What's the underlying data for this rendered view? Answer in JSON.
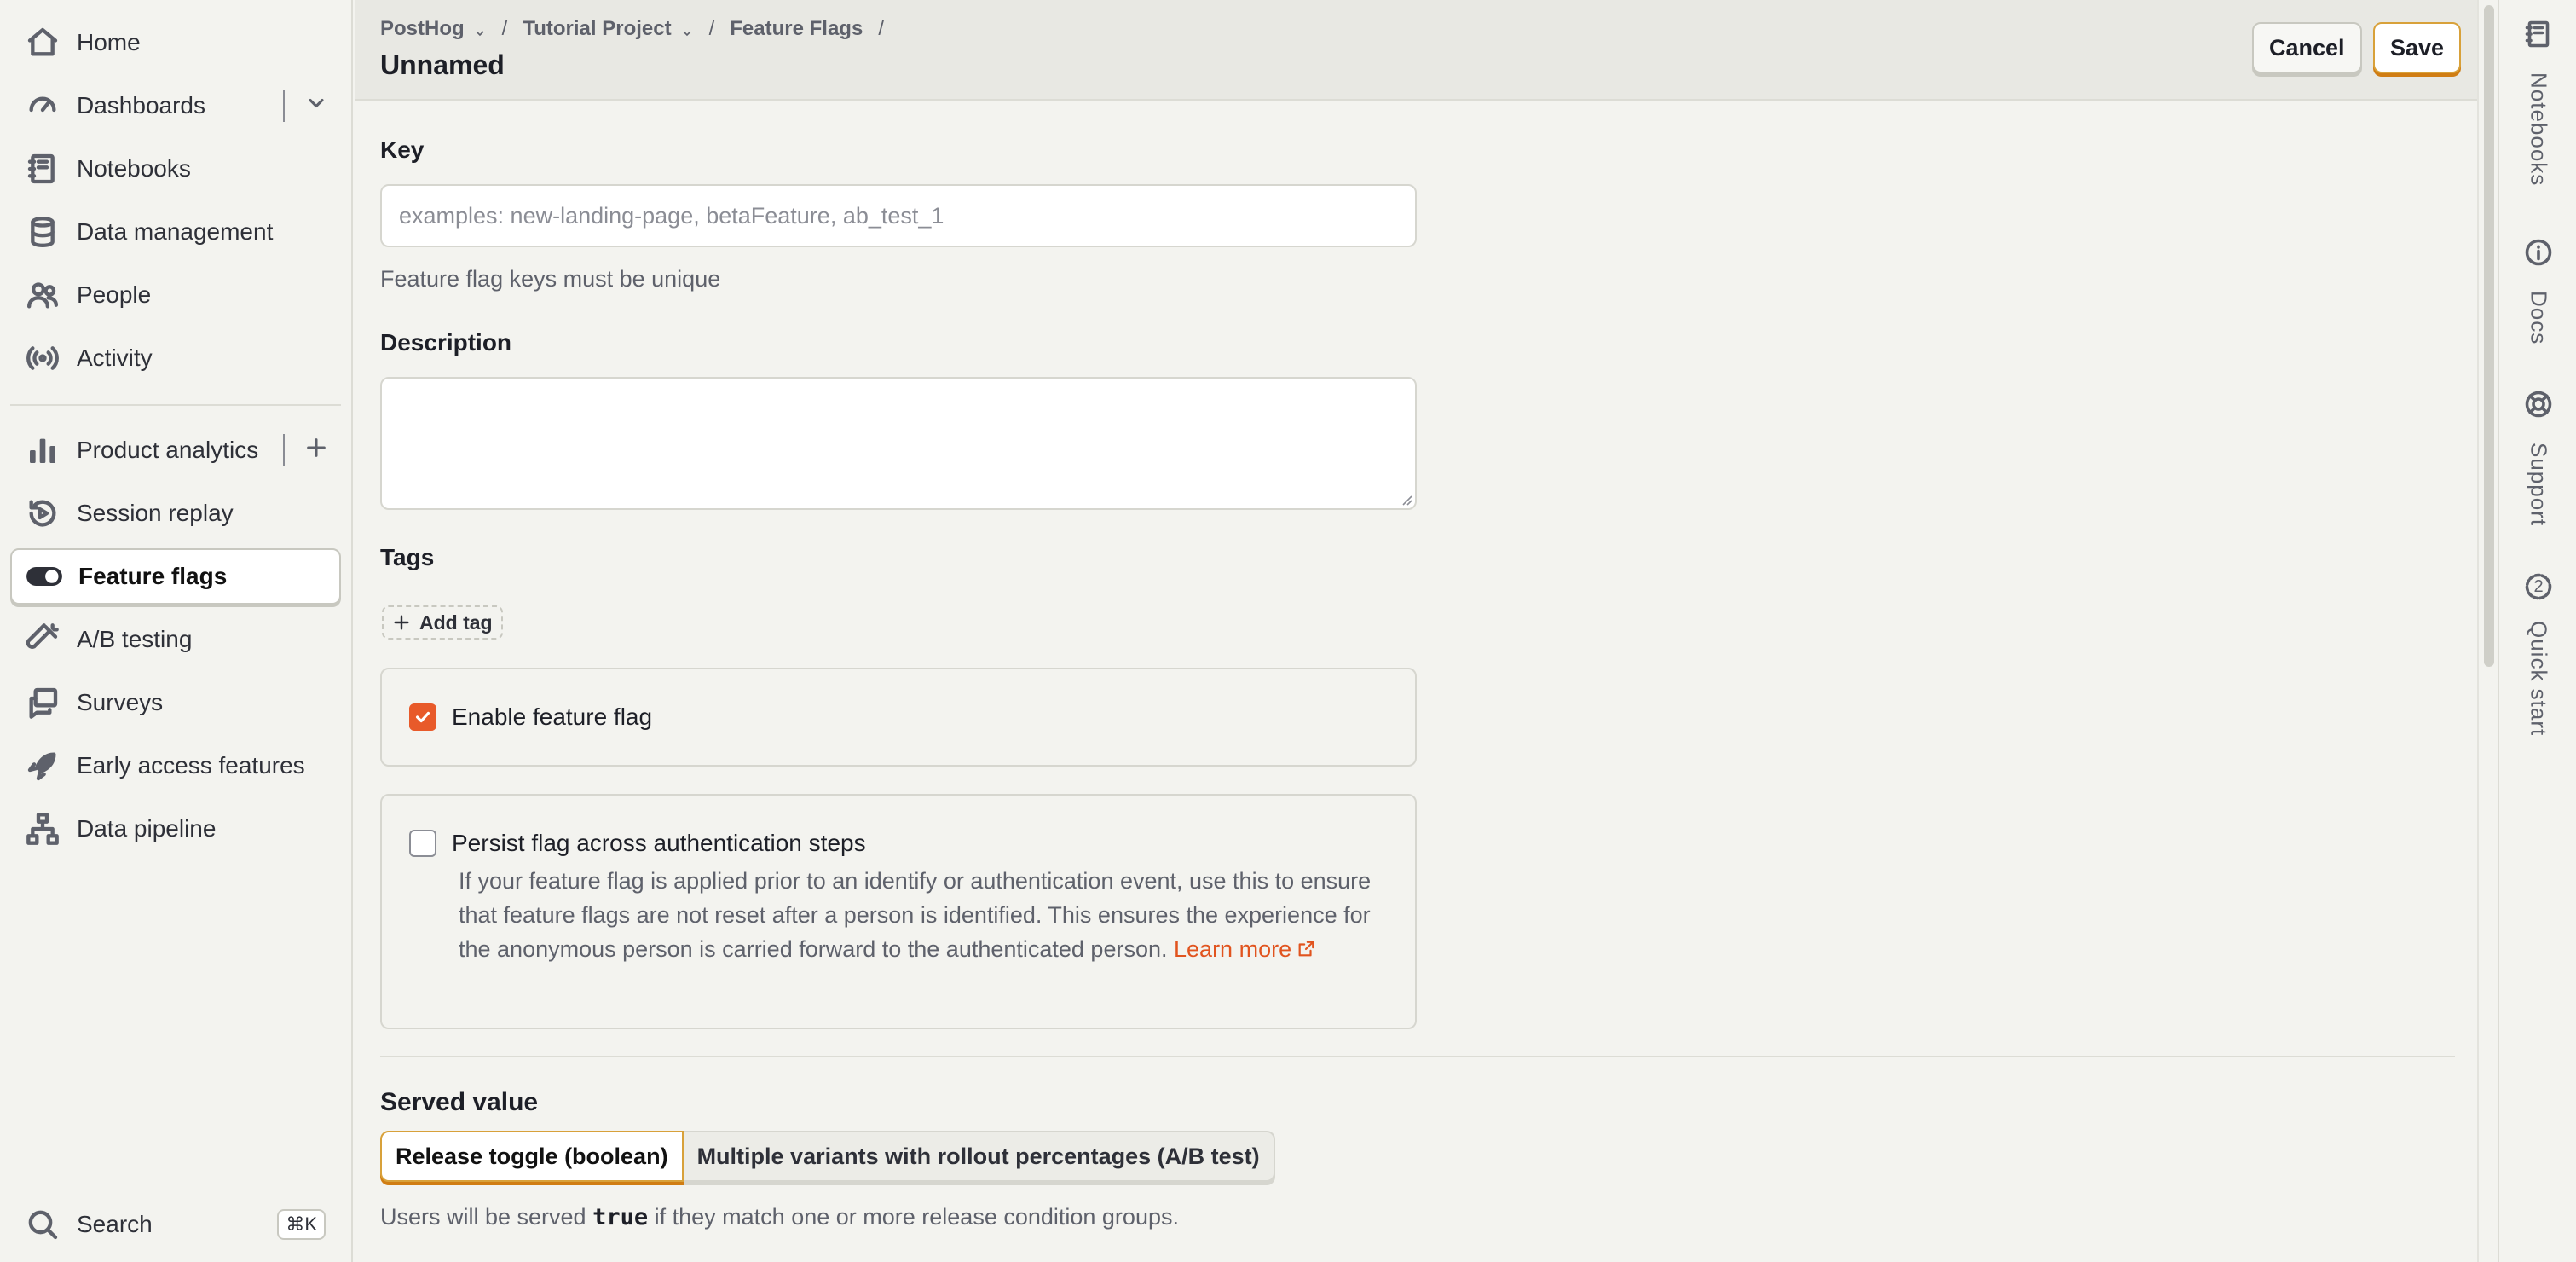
{
  "sidebar": {
    "items": [
      {
        "label": "Home",
        "icon": "home-icon"
      },
      {
        "label": "Dashboards",
        "icon": "dashboard-icon"
      },
      {
        "label": "Notebooks",
        "icon": "notebook-icon"
      },
      {
        "label": "Data management",
        "icon": "database-icon"
      },
      {
        "label": "People",
        "icon": "people-icon"
      },
      {
        "label": "Activity",
        "icon": "activity-icon"
      },
      {
        "label": "Product analytics",
        "icon": "bar-chart-icon"
      },
      {
        "label": "Session replay",
        "icon": "replay-icon"
      },
      {
        "label": "Feature flags",
        "icon": "toggle-icon"
      },
      {
        "label": "A/B testing",
        "icon": "flask-icon"
      },
      {
        "label": "Surveys",
        "icon": "survey-icon"
      },
      {
        "label": "Early access features",
        "icon": "rocket-icon"
      },
      {
        "label": "Data pipeline",
        "icon": "pipeline-icon"
      }
    ],
    "active_item": "Feature flags",
    "search_label": "Search",
    "search_shortcut": "⌘K"
  },
  "header": {
    "breadcrumbs": [
      "PostHog",
      "Tutorial Project",
      "Feature Flags"
    ],
    "title": "Unnamed",
    "cancel_label": "Cancel",
    "save_label": "Save"
  },
  "form": {
    "key_label": "Key",
    "key_placeholder": "examples: new-landing-page, betaFeature, ab_test_1",
    "key_value": "",
    "key_hint": "Feature flag keys must be unique",
    "description_label": "Description",
    "description_value": "",
    "tags_label": "Tags",
    "add_tag_label": "Add tag",
    "enable_label": "Enable feature flag",
    "enable_checked": true,
    "persist_label": "Persist flag across authentication steps",
    "persist_checked": false,
    "persist_description": "If your feature flag is applied prior to an identify or authentication event, use this to ensure that feature flags are not reset after a person is identified. This ensures the experience for the anonymous person is carried forward to the authenticated person.",
    "learn_more_label": "Learn more",
    "served_value_title": "Served value",
    "served_options": [
      "Release toggle (boolean)",
      "Multiple variants with rollout percentages (A/B test)"
    ],
    "served_selected": "Release toggle (boolean)",
    "served_desc_prefix": "Users will be served",
    "served_desc_code": "true",
    "served_desc_suffix": "if they match one or more release condition groups."
  },
  "right_rail": {
    "items": [
      {
        "label": "Notebooks",
        "icon": "notebook-icon"
      },
      {
        "label": "Docs",
        "icon": "info-icon"
      },
      {
        "label": "Support",
        "icon": "lifebuoy-icon"
      },
      {
        "label": "Quick start",
        "icon": "quick-start-icon",
        "badge": "2"
      }
    ]
  },
  "colors": {
    "accent": "#e85a2a",
    "primary_border": "#d07d13",
    "background": "#f3f3ef"
  }
}
